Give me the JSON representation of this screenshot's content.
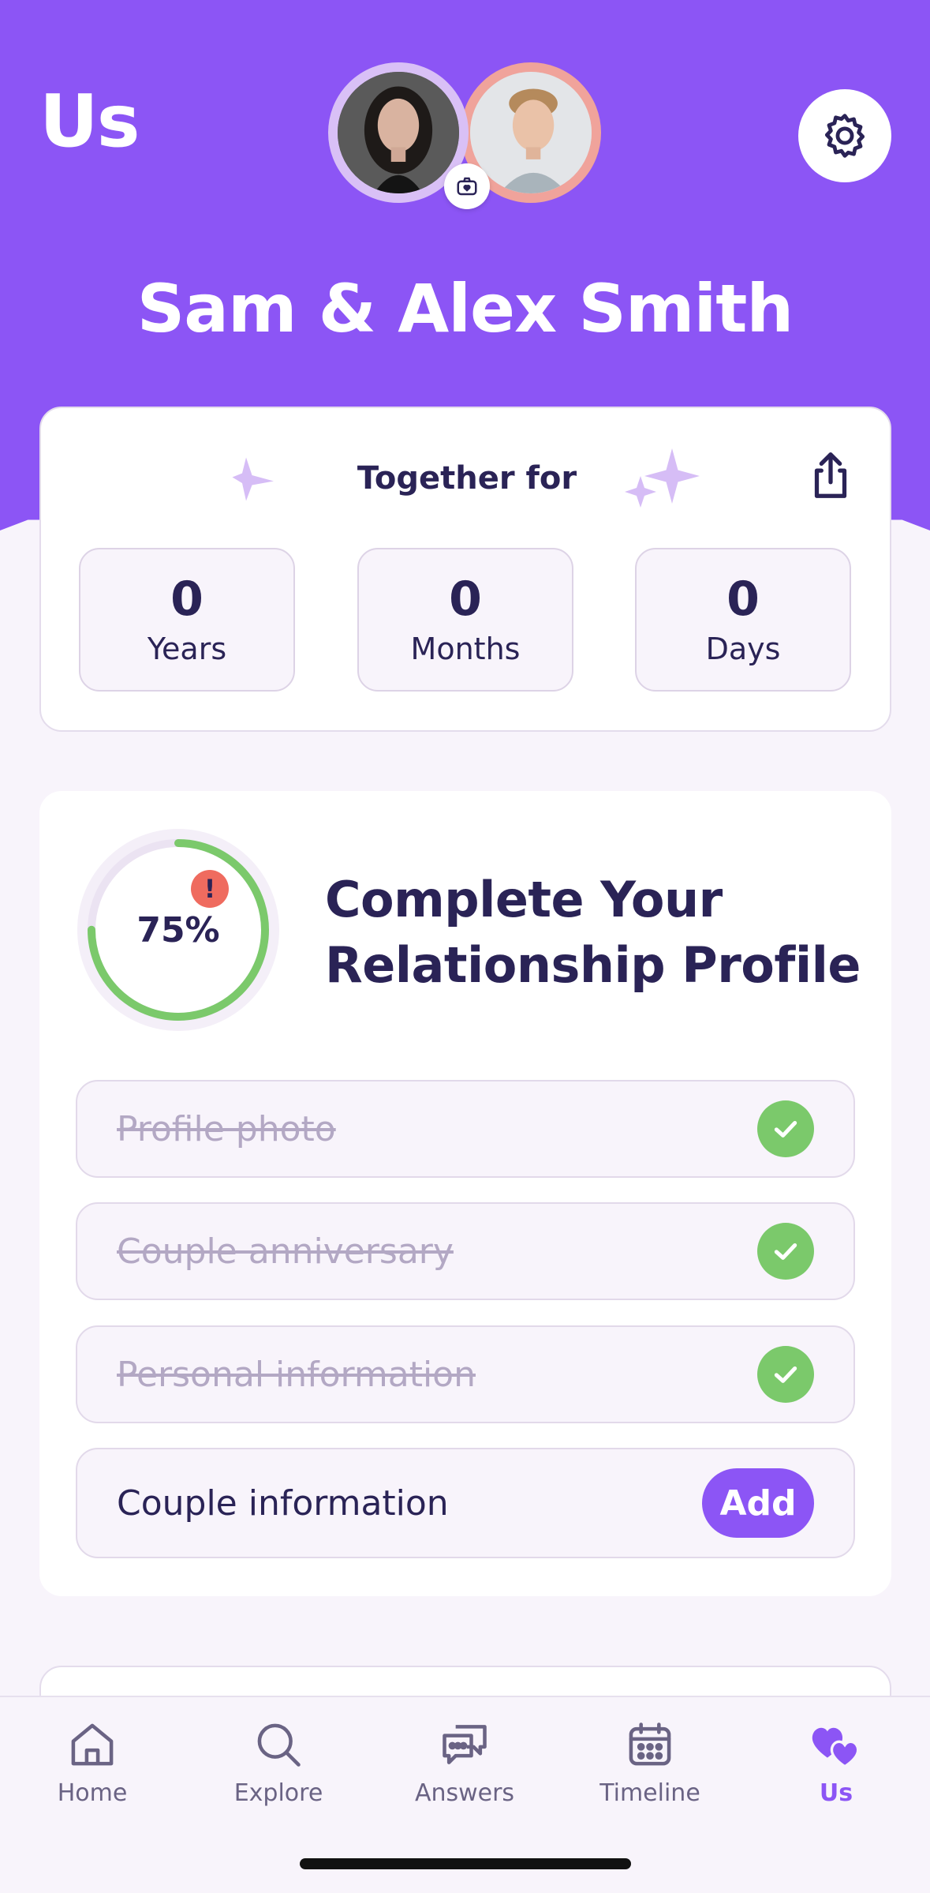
{
  "header": {
    "title": "Us",
    "couple_name": "Sam & Alex Smith"
  },
  "together": {
    "title": "Together for",
    "stats": [
      {
        "value": "0",
        "label": "Years"
      },
      {
        "value": "0",
        "label": "Months"
      },
      {
        "value": "0",
        "label": "Days"
      }
    ]
  },
  "profile": {
    "progress_text": "75%",
    "progress_value": 0.75,
    "alert": "!",
    "title_line1": "Complete Your",
    "title_line2": "Relationship Profile",
    "tasks": [
      {
        "label": "Profile photo",
        "done": true
      },
      {
        "label": "Couple anniversary",
        "done": true
      },
      {
        "label": "Personal information",
        "done": true
      },
      {
        "label": "Couple information",
        "done": false,
        "action": "Add"
      }
    ]
  },
  "tabs": [
    {
      "label": "Home",
      "icon": "home-icon"
    },
    {
      "label": "Explore",
      "icon": "search-icon"
    },
    {
      "label": "Answers",
      "icon": "chat-icon"
    },
    {
      "label": "Timeline",
      "icon": "calendar-icon"
    },
    {
      "label": "Us",
      "icon": "hearts-icon",
      "active": true
    }
  ],
  "colors": {
    "brand": "#8c55f5",
    "success": "#7bc96b",
    "alert": "#ef6b5f",
    "text": "#2a2356"
  }
}
